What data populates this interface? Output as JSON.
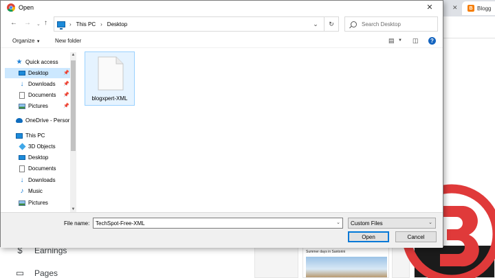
{
  "background": {
    "tab_title": "Blogg",
    "sidebar": [
      {
        "label": "Earnings",
        "icon": "dollar-icon"
      },
      {
        "label": "Pages",
        "icon": "pages-icon"
      }
    ],
    "thumbnail_title": "Summer days in Santorini"
  },
  "dialog": {
    "title": "Open",
    "breadcrumb": [
      "This PC",
      "Desktop"
    ],
    "search_placeholder": "Search Desktop",
    "toolbar": {
      "organize": "Organize",
      "new_folder": "New folder"
    },
    "nav_items": [
      {
        "label": "Quick access",
        "icon": "star-icon",
        "indent": 0,
        "pinned": false,
        "selected": false
      },
      {
        "label": "Desktop",
        "icon": "desktop-folder-icon",
        "indent": 1,
        "pinned": true,
        "selected": true
      },
      {
        "label": "Downloads",
        "icon": "downloads-icon",
        "indent": 1,
        "pinned": true,
        "selected": false
      },
      {
        "label": "Documents",
        "icon": "documents-icon",
        "indent": 1,
        "pinned": true,
        "selected": false
      },
      {
        "label": "Pictures",
        "icon": "pictures-icon",
        "indent": 1,
        "pinned": true,
        "selected": false
      },
      {
        "label": "OneDrive - Persor",
        "icon": "onedrive-icon",
        "indent": 0,
        "pinned": false,
        "selected": false
      },
      {
        "label": "This PC",
        "icon": "this-pc-icon",
        "indent": 0,
        "pinned": false,
        "selected": false
      },
      {
        "label": "3D Objects",
        "icon": "3d-objects-icon",
        "indent": 1,
        "pinned": false,
        "selected": false
      },
      {
        "label": "Desktop",
        "icon": "desktop-folder-icon",
        "indent": 1,
        "pinned": false,
        "selected": false
      },
      {
        "label": "Documents",
        "icon": "documents-icon",
        "indent": 1,
        "pinned": false,
        "selected": false
      },
      {
        "label": "Downloads",
        "icon": "downloads-icon",
        "indent": 1,
        "pinned": false,
        "selected": false
      },
      {
        "label": "Music",
        "icon": "music-icon",
        "indent": 1,
        "pinned": false,
        "selected": false
      },
      {
        "label": "Pictures",
        "icon": "pictures-icon",
        "indent": 1,
        "pinned": false,
        "selected": false
      }
    ],
    "files": [
      {
        "name": "blogxpert-XML",
        "icon": "blank-file-icon",
        "selected": true
      }
    ],
    "file_name_label": "File name:",
    "file_name_value": "TechSpot-Free-XML",
    "file_type": "Custom Files",
    "open_label": "Open",
    "cancel_label": "Cancel"
  },
  "colors": {
    "logo_red": "#e03a3a",
    "selection": "#cce8ff",
    "accent": "#0078d7"
  }
}
